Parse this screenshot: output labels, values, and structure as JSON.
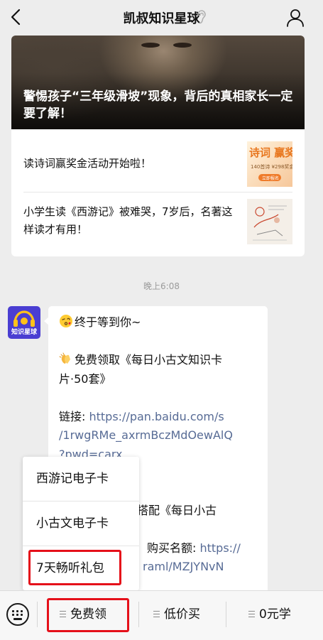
{
  "header": {
    "title": "凯叔知识星球"
  },
  "articles": {
    "cover_title": "警惕孩子“三年级滑坡”现象，背后的真相家长一定要了解！",
    "items": [
      {
        "title": "读诗词赢奖金活动开始啦！",
        "thumb_text_main": "诗词 赢奖",
        "thumb_text_sub": "140首诗  ¥298奖金",
        "thumb_button": "立即报名"
      },
      {
        "title": "小学生读《西游记》被难哭，7岁后，名著这样读才有用！",
        "thumb_text_main": "西游记"
      }
    ]
  },
  "timestamp": "晚上6:08",
  "sender": {
    "avatar_label": "知识星球",
    "avatar_color": "#4a3ed2"
  },
  "message": {
    "line1": "终于等到你~",
    "line2a": "免费领取《每日小古文知识卡",
    "line2b": "片·50套》",
    "link_label": "链接: ",
    "link_1": "https://pan.baidu.com/s",
    "link_2": "/1rwgRMe_axrmBczMdOewAlQ",
    "link_3": "?pwd=carx",
    "partial_1": "搭配《每日小古",
    "partial_2": "购买名额: ",
    "partial_2_link": "https://",
    "partial_3": "raml/MZJYNvN"
  },
  "popup_menu": {
    "items": [
      "西游记电子卡",
      "小古文电子卡",
      "7天畅听礼包"
    ]
  },
  "bottom_menu": {
    "tabs": [
      "免费领",
      "低价买",
      "0元学"
    ]
  },
  "colors": {
    "link": "#576b95",
    "highlight": "#e5101a"
  }
}
